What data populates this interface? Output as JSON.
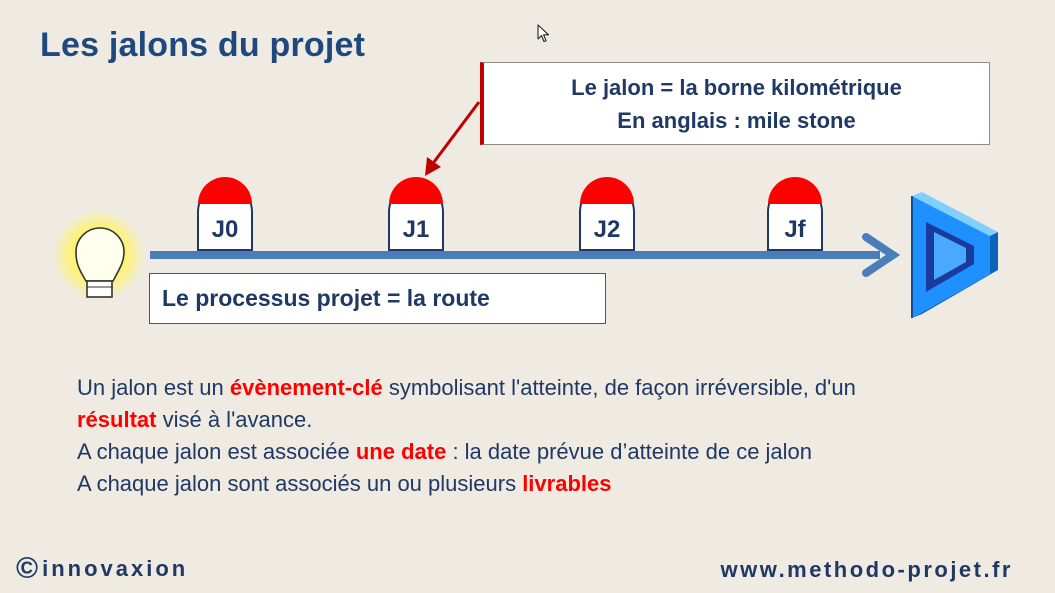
{
  "title": "Les jalons du projet",
  "callout": {
    "line1": "Le jalon = la borne kilométrique",
    "line2": "En anglais : mile stone"
  },
  "milestones": [
    {
      "label": "J0"
    },
    {
      "label": "J1"
    },
    {
      "label": "J2"
    },
    {
      "label": "Jf"
    }
  ],
  "route_label": "Le processus projet = la route",
  "description": {
    "l1_a": "Un jalon est un ",
    "l1_kw": "évènement-clé",
    "l1_b": " symbolisant l'atteinte, de façon irréversible, d'un",
    "l2_kw": "résultat",
    "l2_b": " visé à l'avance.",
    "l3_a": "A chaque jalon est associée ",
    "l3_kw": "une date",
    "l3_b": " : la date prévue d’atteinte de ce jalon",
    "l4_a": "A chaque jalon sont associés un ou plusieurs ",
    "l4_kw": "livrables"
  },
  "footer": {
    "copyright_symbol": "©",
    "brand": "innovaxion",
    "url": "www.methodo-projet.fr"
  },
  "icons": {
    "start": "lightbulb-icon",
    "end": "goal-frame-icon",
    "pointer": "mouse-cursor-icon"
  },
  "colors": {
    "title": "#1f497d",
    "text": "#1f3864",
    "keyword": "#ff0000",
    "arrow": "#4a7ebb",
    "milestone_cap": "#ff0000",
    "background": "#efebe2"
  }
}
